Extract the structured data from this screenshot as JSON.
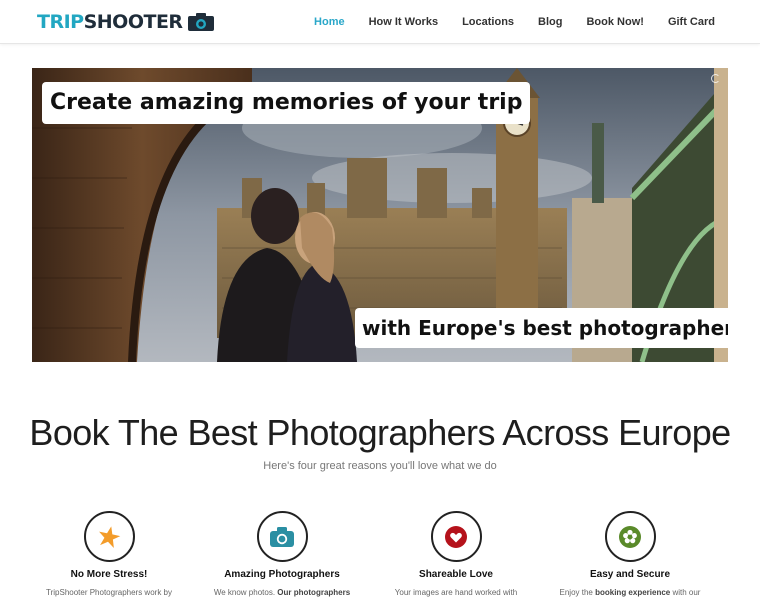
{
  "brand": {
    "part1": "TRIP",
    "part2": "SHOOTER",
    "accent": "#22a7c2"
  },
  "nav": {
    "items": [
      {
        "label": "Home",
        "active": true
      },
      {
        "label": "How It Works"
      },
      {
        "label": "Locations"
      },
      {
        "label": "Blog"
      },
      {
        "label": "Book Now!"
      },
      {
        "label": "Gift Card"
      }
    ]
  },
  "hero": {
    "caption_top": "Create amazing memories of your trip",
    "caption_bottom": "with Europe's best photographers"
  },
  "main": {
    "headline": "Book The Best Photographers Across Europe",
    "subhead": "Here's four great reasons you'll love what we do"
  },
  "features": [
    {
      "title": "No More Stress!",
      "desc": "TripShooter Photographers work by",
      "icon": "star-icon",
      "color": "#f39c2a"
    },
    {
      "title": "Amazing Photographers",
      "desc_pre": "We know photos. ",
      "desc_bold": "Our photographers",
      "icon": "camera-icon",
      "color": "#2a8fa3"
    },
    {
      "title": "Shareable Love",
      "desc": "Your images are hand worked with",
      "icon": "heart-icon",
      "color": "#b5121b"
    },
    {
      "title": "Easy and Secure",
      "desc_pre": "Enjoy the ",
      "desc_bold": "booking experience",
      "desc_post": " with our",
      "icon": "flower-icon",
      "color": "#5a8a2a"
    }
  ]
}
